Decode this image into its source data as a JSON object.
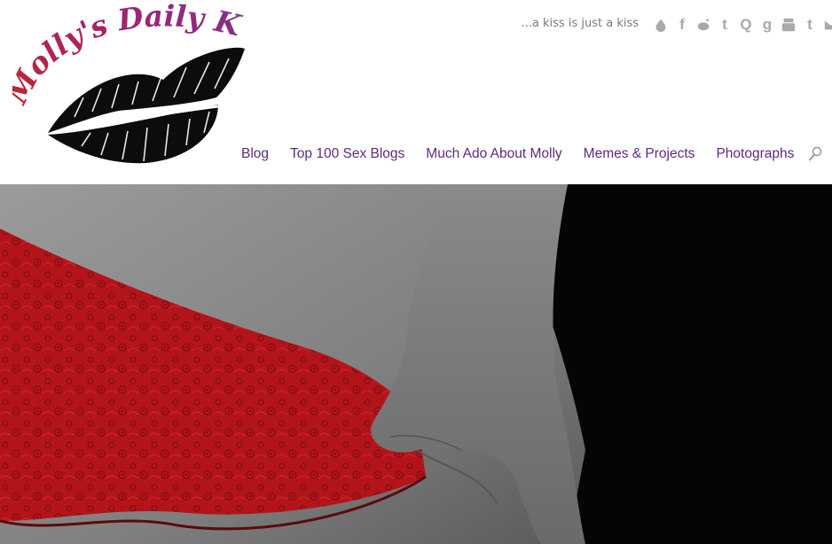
{
  "site": {
    "logo_text": "Molly's Daily Kiss",
    "tagline": "...a kiss is just a kiss"
  },
  "social_icons": [
    "kiss-icon",
    "facebook-icon",
    "reddit-icon",
    "twitter-icon",
    "quora-icon",
    "google-icon",
    "youtube-icon",
    "tumblr-icon",
    "mail-icon"
  ],
  "nav": {
    "items": [
      {
        "label": "Blog"
      },
      {
        "label": "Top 100 Sex Blogs"
      },
      {
        "label": "Much Ado About Molly"
      },
      {
        "label": "Memes & Projects"
      },
      {
        "label": "Photographs"
      }
    ]
  },
  "colors": {
    "nav_text": "#5c2b7a",
    "logo_gradient_start": "#c2262e",
    "logo_gradient_end": "#6a3ba0",
    "lace_red": "#b3141a",
    "icon_gray": "#a9a9a9"
  }
}
